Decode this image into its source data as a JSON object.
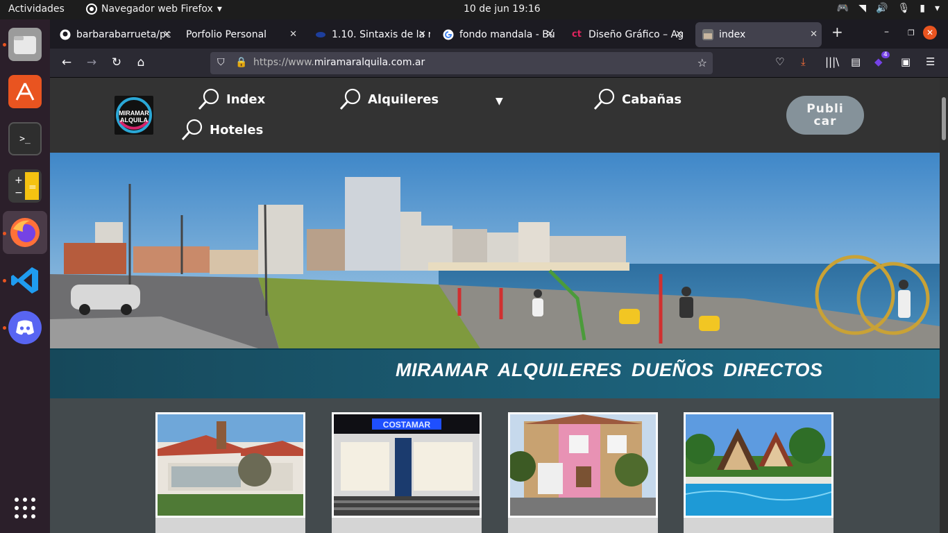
{
  "topbar": {
    "activities": "Actividades",
    "app_menu": "Navegador web Firefox",
    "clock": "10 de jun  19:16"
  },
  "tabs": [
    {
      "title": "barbarabarrueta/pc",
      "icon": "github-icon"
    },
    {
      "title": "Porfolio Personal",
      "icon": "none"
    },
    {
      "title": "1.10. Sintaxis de la r",
      "icon": "doc-icon"
    },
    {
      "title": "fondo mandala - Bú",
      "icon": "google-icon"
    },
    {
      "title": "Diseño Gráfico – Ag",
      "icon": "ct-icon"
    },
    {
      "title": "index",
      "icon": "page-icon"
    }
  ],
  "url": {
    "prefix": "https://www.",
    "domain": "miramaralquila.com.ar"
  },
  "site": {
    "logo_line1": "MIRAMAR",
    "logo_line2": "ALQUILA",
    "nav": {
      "index": "Index",
      "alquileres": "Alquileres",
      "cabanas": "Cabañas",
      "hoteles": "Hoteles"
    },
    "publicar_line1": "Publi",
    "publicar_line2": "car",
    "banner_title": "MIRAMAR  ALQUILERES  DUEÑOS DIRECTOS",
    "card3_sign": "COSTAMAR"
  },
  "extensions_badge": "4",
  "colors": {
    "accent": "#e95420",
    "banner": "#1f6c88",
    "nav_bg": "#333333"
  }
}
